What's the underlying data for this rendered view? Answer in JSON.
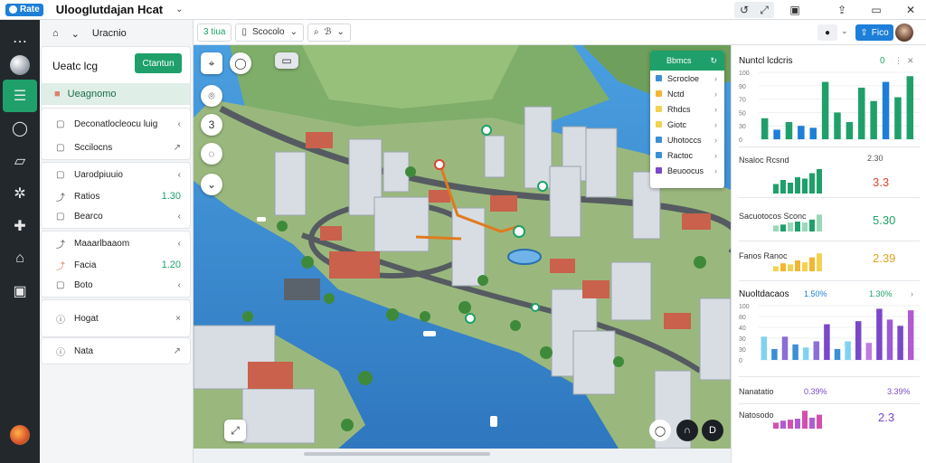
{
  "app": {
    "logo_text": "Rate",
    "title": "Ulooglutdajan Hcat"
  },
  "titlebar": {
    "icons": [
      "history-icon",
      "expand-icon",
      "device-icon",
      "share-icon",
      "minimize-icon",
      "close-icon"
    ]
  },
  "rail": {
    "items": [
      "disc-icon",
      "layers-icon",
      "circle-icon",
      "book-icon",
      "network-icon",
      "plus-icon",
      "home-icon",
      "download-icon"
    ]
  },
  "left_panel": {
    "header": "Uracnio",
    "subtitle": "Ueatc lcg",
    "primary_button": "Ctantun",
    "active_item": "Ueagnomo",
    "rows": [
      {
        "label": "Deconatlocleocu luig",
        "right": "‹"
      },
      {
        "label": "Sccilocns",
        "right": "↗"
      },
      {
        "label": "Uarodpiuuio",
        "right": "‹"
      },
      {
        "label": "Ratios",
        "right": "1.30"
      },
      {
        "label": "Bearco",
        "right": "‹"
      },
      {
        "label": "Maaarlbaaom",
        "right": "‹"
      },
      {
        "label": "Facia",
        "right": "1.20"
      },
      {
        "label": "Boto",
        "right": "‹"
      },
      {
        "label": "Hogat",
        "right": "×"
      },
      {
        "label": "Nata",
        "right": "↗"
      }
    ]
  },
  "map_toolbar": {
    "chip1": "3 tiua",
    "chip2": "Scocolo",
    "chip3": "ℬ"
  },
  "layers": {
    "title": "Bbmcs",
    "items": [
      {
        "label": "Scrocloe",
        "color": "#3b8fd6"
      },
      {
        "label": "Nctd",
        "color": "#f2b632"
      },
      {
        "label": "Rhdcs",
        "color": "#f2d250"
      },
      {
        "label": "Giotc",
        "color": "#f2d250"
      },
      {
        "label": "Uhotoccs",
        "color": "#3b8fd6"
      },
      {
        "label": "Ractoc",
        "color": "#3b8fd6"
      },
      {
        "label": "Beuoocus",
        "color": "#7a48c9"
      }
    ]
  },
  "right_panel": {
    "button": "Fico",
    "section1_title": "Nuntcl lcdcris",
    "section1_value": "0",
    "section1_ticks_y": [
      "100",
      "90",
      "70",
      "50",
      "30",
      "0"
    ],
    "rows": [
      {
        "label": "Nsaloc Rcsnd",
        "value": "2.30",
        "stat": "3.3"
      },
      {
        "label": "Sacuotocos Sconc",
        "value": "",
        "stat": "5.30"
      },
      {
        "label": "Fanos Ranoc",
        "value": "",
        "stat": "2.39"
      }
    ],
    "section2_title": "Nuoltdacaos",
    "section2_stat1": "1.50%",
    "section2_stat2": "1.30%",
    "section2_ticks_y": [
      "100",
      "80",
      "40",
      "30",
      "30",
      "0"
    ],
    "bottom_rows": [
      {
        "label": "Nanatatio",
        "stat1": "0.39%",
        "stat2": "3.39%"
      },
      {
        "label": "Natosodo",
        "stat1": "",
        "stat2": "2.3"
      }
    ]
  },
  "chart_data": [
    {
      "type": "bar",
      "title": "Nuntcl lcdcris",
      "series": [
        {
          "values": [
            22,
            10,
            18,
            14,
            12,
            60,
            28,
            18,
            54,
            40,
            60,
            44,
            66
          ]
        }
      ]
    },
    {
      "type": "bar",
      "title": "Nuoltdacaos",
      "series": [
        {
          "values": [
            30,
            14,
            30,
            20,
            16,
            24,
            46,
            14,
            24,
            50,
            22,
            66,
            52,
            44,
            64
          ]
        }
      ]
    }
  ],
  "colors": {
    "accent": "#1fa06a",
    "blue": "#3b8fd6",
    "purple": "#7a48c9",
    "pink": "#d34fae",
    "yellow": "#f2c232"
  }
}
